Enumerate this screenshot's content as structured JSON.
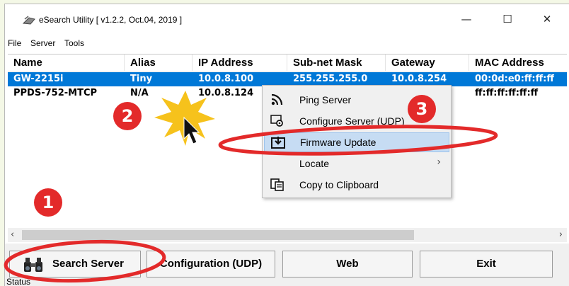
{
  "window": {
    "title": "eSearch Utility [ v1.2.2, Oct.04, 2019 ]",
    "controls": {
      "minimize": "—",
      "maximize": "☐",
      "close": "✕"
    }
  },
  "menu": [
    "File",
    "Server",
    "Tools"
  ],
  "table": {
    "headers": [
      "Name",
      "Alias",
      "IP Address",
      "Sub-net Mask",
      "Gateway",
      "MAC Address"
    ],
    "rows": [
      [
        "GW-2215i",
        "Tiny",
        "10.0.8.100",
        "255.255.255.0",
        "10.0.8.254",
        "00:0d:e0:ff:ff:ff"
      ],
      [
        "PPDS-752-MTCP",
        "N/A",
        "10.0.8.124",
        "",
        "",
        "ff:ff:ff:ff:ff:ff"
      ]
    ],
    "selected_row": 0
  },
  "context_menu": {
    "items": [
      {
        "label": "Ping Server",
        "icon": "signal-icon"
      },
      {
        "label": "Configure Server (UDP)",
        "icon": "gear-icon"
      },
      {
        "label": "Firmware Update",
        "icon": "download-icon",
        "highlighted": true
      },
      {
        "label": "Locate",
        "icon": "",
        "submenu": "›"
      },
      {
        "label": "Copy to Clipboard",
        "icon": "clipboard-icon"
      }
    ]
  },
  "buttons": {
    "search": "Search Server",
    "configuration": "Configuration (UDP)",
    "web": "Web",
    "exit": "Exit"
  },
  "scrollbar": {
    "left_arrow": "‹",
    "right_arrow": "›"
  },
  "status": "Status",
  "steps": [
    "1",
    "2",
    "3"
  ],
  "colors": {
    "selection": "#0078d7",
    "highlight_menu": "#c6dcf3",
    "annotation_red": "#e32a2a",
    "burst_yellow": "#f6c21c"
  }
}
